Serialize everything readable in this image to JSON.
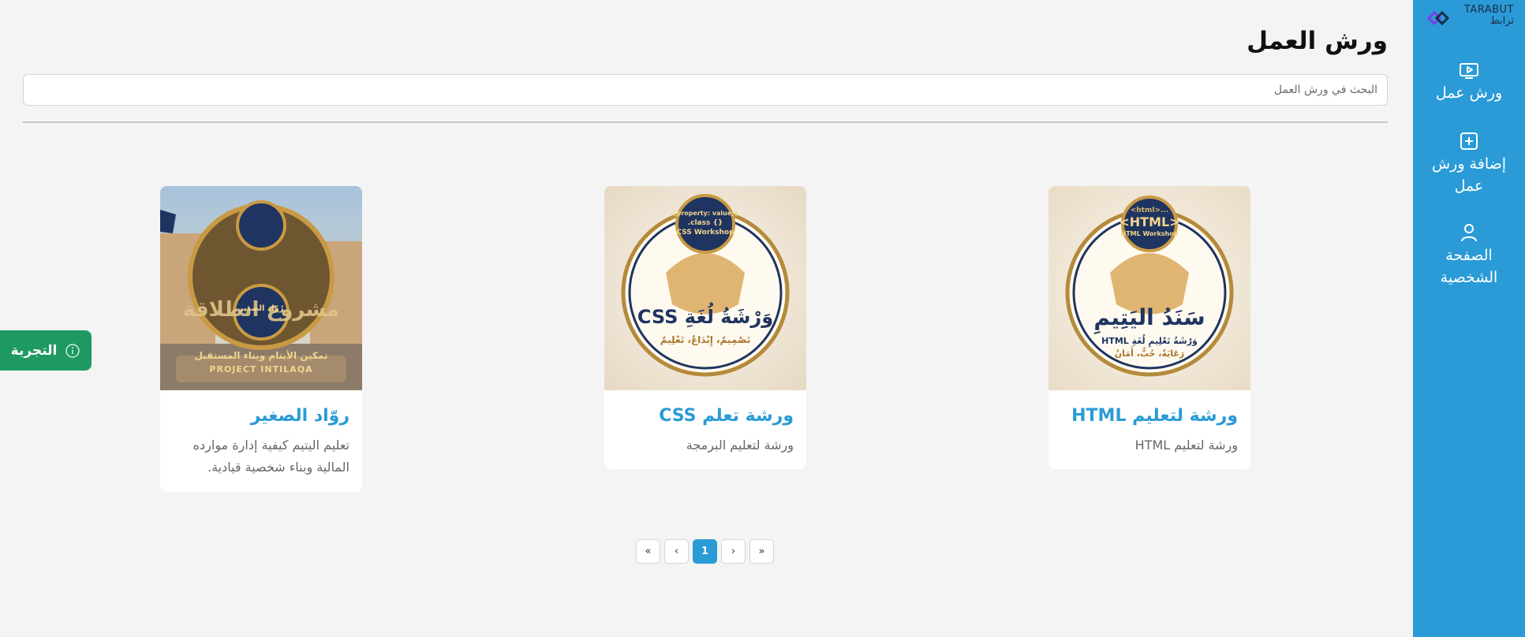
{
  "brand": {
    "name_latin": "TARABUT",
    "name_arabic": "ترابط",
    "accent_color": "#2a9bd6"
  },
  "sidebar": {
    "items": [
      {
        "label": "ورش عمل",
        "icon": "video-play-icon"
      },
      {
        "label": "إضافة ورش عمل",
        "icon": "plus-square-icon"
      },
      {
        "label": "الصفحة الشخصية",
        "icon": "user-icon"
      }
    ]
  },
  "main": {
    "title": "ورش العمل",
    "search": {
      "placeholder": "البحث في ورش العمل",
      "value": ""
    }
  },
  "workshops": [
    {
      "title": "ورشة لتعليم HTML",
      "description": "ورشة لتعليم HTML",
      "image": {
        "badge_top": "<html>...",
        "badge_main": "<HTML>",
        "badge_sub": "HTML Workshop",
        "headline": "سَنَدُ اليَتِيمِ",
        "line": "وَرْشَةُ تَعْلِيمِ لُغَةِ HTML",
        "tagline": "رَعَايَةٌ، حُبٌّ، أَمَانٌ"
      }
    },
    {
      "title": "ورشة تعلم CSS",
      "description": "ورشة لتعليم البرمجة",
      "image": {
        "badge_top": "{property: value;}",
        "badge_main": ".class {}",
        "badge_sub": "CSS Workshop",
        "headline": "وَرْشَةُ لُغَةِ CSS",
        "tagline": "تَصْمِيمٌ، إِبْدَاعٌ، تَعْلِيمٌ"
      }
    },
    {
      "title": "روّاد الصغير",
      "description": "تعليم اليتيم كيفية إدارة موارده المالية وبناء شخصية قيادية.",
      "image": {
        "headline": "مشروع انطلاقة",
        "badge_main": "رُوّاد الصغير",
        "line": "تمكين الأيتام وبناء المستقبل",
        "tagline": "PROJECT INTILAQA"
      }
    }
  ],
  "trial_tab": {
    "label": "التجربة",
    "icon": "info-circle-icon",
    "color": "#1f9962"
  },
  "pagination": {
    "first": "«",
    "prev": "‹",
    "current": "1",
    "next": "›",
    "last": "»"
  }
}
